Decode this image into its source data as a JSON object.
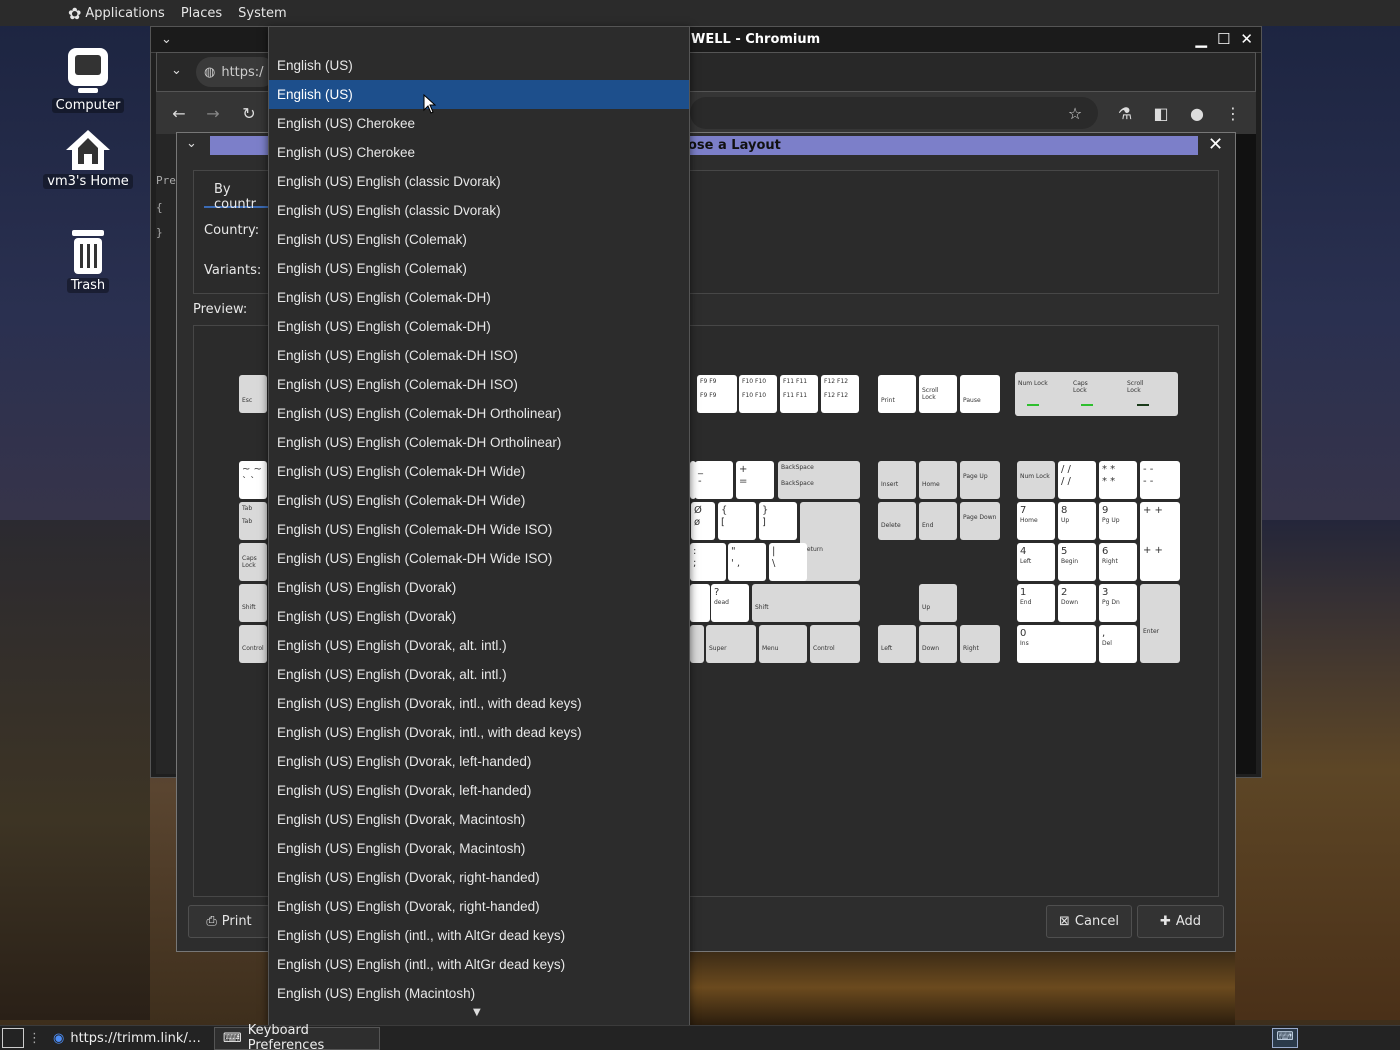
{
  "top_panel": {
    "applications": "Applications",
    "places": "Places",
    "system": "System"
  },
  "desktop": {
    "computer": "Computer",
    "home": "vm3's Home",
    "trash": "Trash"
  },
  "chromium": {
    "title": "WELL - Chromium",
    "url_fragment": "https:/"
  },
  "dialog": {
    "title": "ose a Layout",
    "tab_by_country": "By countr",
    "country_label": "Country:",
    "variants_label": "Variants:",
    "preview_label": "Preview:",
    "print_label": "Print",
    "cancel_label": "Cancel",
    "add_label": "Add",
    "side_text": [
      "Pre",
      "{",
      "}"
    ]
  },
  "dropdown": {
    "items": [
      "English (US)",
      "English (US)",
      "English (US) Cherokee",
      "English (US) Cherokee",
      "English (US) English (classic Dvorak)",
      "English (US) English (classic Dvorak)",
      "English (US) English (Colemak)",
      "English (US) English (Colemak)",
      "English (US) English (Colemak-DH)",
      "English (US) English (Colemak-DH)",
      "English (US) English (Colemak-DH ISO)",
      "English (US) English (Colemak-DH ISO)",
      "English (US) English (Colemak-DH Ortholinear)",
      "English (US) English (Colemak-DH Ortholinear)",
      "English (US) English (Colemak-DH Wide)",
      "English (US) English (Colemak-DH Wide)",
      "English (US) English (Colemak-DH Wide ISO)",
      "English (US) English (Colemak-DH Wide ISO)",
      "English (US) English (Dvorak)",
      "English (US) English (Dvorak)",
      "English (US) English (Dvorak, alt. intl.)",
      "English (US) English (Dvorak, alt. intl.)",
      "English (US) English (Dvorak, intl., with dead keys)",
      "English (US) English (Dvorak, intl., with dead keys)",
      "English (US) English (Dvorak, left-handed)",
      "English (US) English (Dvorak, left-handed)",
      "English (US) English (Dvorak, Macintosh)",
      "English (US) English (Dvorak, Macintosh)",
      "English (US) English (Dvorak, right-handed)",
      "English (US) English (Dvorak, right-handed)",
      "English (US) English (intl., with AltGr dead keys)",
      "English (US) English (intl., with AltGr dead keys)",
      "English (US) English (Macintosh)"
    ],
    "selected_index": 1
  },
  "keyboard": {
    "esc": "Esc",
    "f9": "F9",
    "f10": "F10",
    "f11": "F11",
    "f12": "F12",
    "print": "Print",
    "scroll_lock": "Scroll Lock",
    "pause": "Pause",
    "num_lock": "Num Lock",
    "caps_lock": "Caps Lock",
    "backspace": "BackSpace",
    "tab": "Tab",
    "shift": "Shift",
    "control": "Control",
    "return": "Return",
    "super": "Super",
    "menu": "Menu",
    "insert": "Insert",
    "home": "Home",
    "page_up": "Page Up",
    "delete": "Delete",
    "end": "End",
    "page_down": "Page Down",
    "up": "Up",
    "left": "Left",
    "down": "Down",
    "right": "Right",
    "enter": "Enter",
    "ins": "Ins",
    "del": "Del",
    "begin": "Begin",
    "pg_up": "Pg Up",
    "pg_dn": "Pg Dn",
    "dead": "dead"
  },
  "taskbar": {
    "chromium_task": "https://trimm.link/…",
    "keyboard_task": "Keyboard Preferences"
  },
  "colors": {
    "selection": "#1d4f8c",
    "dialog_title": "#7c7fc9",
    "led": "#2fbf2f"
  }
}
